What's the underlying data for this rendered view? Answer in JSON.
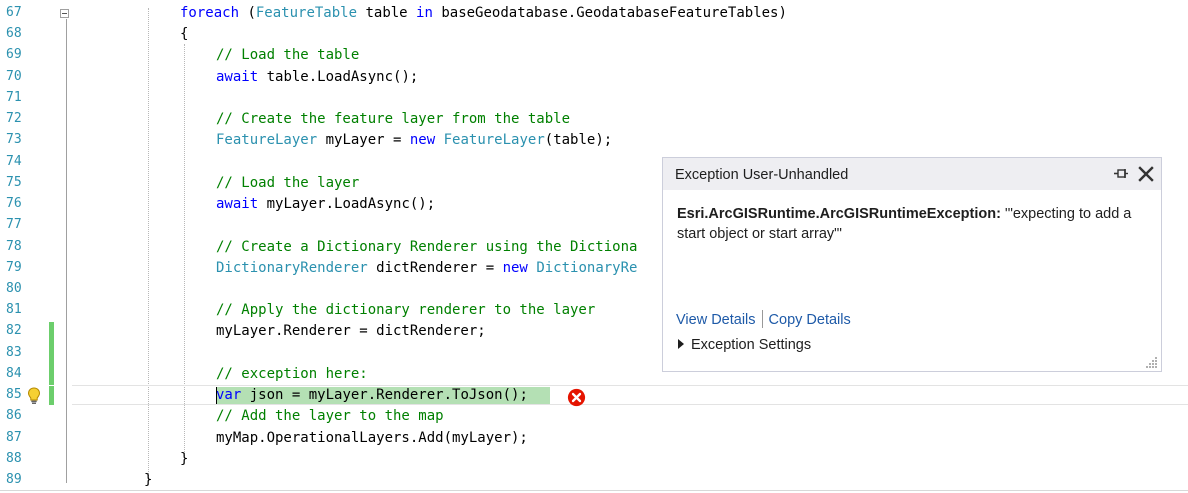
{
  "editor": {
    "lines": [
      {
        "num": "67",
        "tokens": [
          {
            "t": "kw",
            "v": "foreach"
          },
          {
            "t": "tx",
            "v": " ("
          },
          {
            "t": "ty",
            "v": "FeatureTable"
          },
          {
            "t": "tx",
            "v": " table "
          },
          {
            "t": "kw",
            "v": "in"
          },
          {
            "t": "tx",
            "v": " baseGeodatabase.GeodatabaseFeatureTables)"
          }
        ]
      },
      {
        "num": "68",
        "tokens": [
          {
            "t": "tx",
            "v": "{"
          }
        ]
      },
      {
        "num": "69",
        "tokens": [
          {
            "t": "cm",
            "v": "// Load the table"
          }
        ]
      },
      {
        "num": "70",
        "tokens": [
          {
            "t": "kw",
            "v": "await"
          },
          {
            "t": "tx",
            "v": " table.LoadAsync();"
          }
        ]
      },
      {
        "num": "71",
        "tokens": []
      },
      {
        "num": "72",
        "tokens": [
          {
            "t": "cm",
            "v": "// Create the feature layer from the table"
          }
        ]
      },
      {
        "num": "73",
        "tokens": [
          {
            "t": "ty",
            "v": "FeatureLayer"
          },
          {
            "t": "tx",
            "v": " myLayer = "
          },
          {
            "t": "kw",
            "v": "new"
          },
          {
            "t": "tx",
            "v": " "
          },
          {
            "t": "ty",
            "v": "FeatureLayer"
          },
          {
            "t": "tx",
            "v": "(table);"
          }
        ]
      },
      {
        "num": "74",
        "tokens": []
      },
      {
        "num": "75",
        "tokens": [
          {
            "t": "cm",
            "v": "// Load the layer"
          }
        ]
      },
      {
        "num": "76",
        "tokens": [
          {
            "t": "kw",
            "v": "await"
          },
          {
            "t": "tx",
            "v": " myLayer.LoadAsync();"
          }
        ]
      },
      {
        "num": "77",
        "tokens": []
      },
      {
        "num": "78",
        "tokens": [
          {
            "t": "cm",
            "v": "// Create a Dictionary Renderer using the Dictiona"
          }
        ]
      },
      {
        "num": "79",
        "tokens": [
          {
            "t": "ty",
            "v": "DictionaryRenderer"
          },
          {
            "t": "tx",
            "v": " dictRenderer = "
          },
          {
            "t": "kw",
            "v": "new"
          },
          {
            "t": "tx",
            "v": " "
          },
          {
            "t": "ty",
            "v": "DictionaryRe"
          }
        ]
      },
      {
        "num": "80",
        "tokens": []
      },
      {
        "num": "81",
        "tokens": [
          {
            "t": "cm",
            "v": "// Apply the dictionary renderer to the layer"
          }
        ]
      },
      {
        "num": "82",
        "tokens": [
          {
            "t": "tx",
            "v": "myLayer.Renderer = dictRenderer;"
          }
        ]
      },
      {
        "num": "83",
        "tokens": []
      },
      {
        "num": "84",
        "tokens": [
          {
            "t": "cm",
            "v": "// exception here:"
          }
        ]
      },
      {
        "num": "85",
        "tokens": [
          {
            "t": "kw",
            "v": "var"
          },
          {
            "t": "tx",
            "v": " json = myLayer.Renderer.ToJson();"
          }
        ]
      },
      {
        "num": "86",
        "tokens": [
          {
            "t": "cm",
            "v": "// Add the layer to the map"
          }
        ]
      },
      {
        "num": "87",
        "tokens": [
          {
            "t": "tx",
            "v": "myMap.OperationalLayers.Add(myLayer);"
          }
        ]
      },
      {
        "num": "88",
        "tokens": [
          {
            "t": "tx",
            "v": "}"
          }
        ]
      },
      {
        "num": "89",
        "tokens": [
          {
            "t": "tx",
            "v": "}"
          }
        ]
      }
    ],
    "colors": {
      "keyword": "#0000ff",
      "type": "#2b91af",
      "comment": "#008000",
      "line_number": "#2b91af",
      "changed_bar": "#6cce6c",
      "exec_highlight": "#b4e0b4"
    },
    "icons": {
      "lightbulb": "lightbulb-icon",
      "error": "error-circle-icon"
    }
  },
  "popup": {
    "title": "Exception User-Unhandled",
    "exception_type": "Esri.ArcGISRuntime.ArcGISRuntimeException:",
    "exception_message": " '\"expecting to add a start object or start array\"'",
    "view_details": "View Details",
    "copy_details": "Copy Details",
    "exception_settings": "Exception Settings",
    "icons": {
      "pin": "pin-icon",
      "close": "close-icon",
      "expand": "expand-triangle-icon",
      "resize": "resize-grip-icon"
    }
  }
}
